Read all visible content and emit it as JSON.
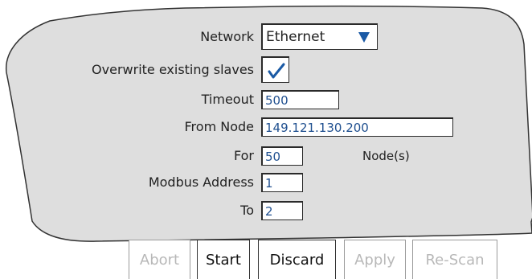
{
  "form": {
    "network_label": "Network",
    "network_value": "Ethernet",
    "overwrite_label": "Overwrite existing slaves",
    "overwrite_checked": true,
    "timeout_label": "Timeout",
    "timeout_value": "500",
    "from_node_label": "From Node",
    "from_node_value": "149.121.130.200",
    "for_label": "For",
    "for_value": "50",
    "for_unit": "Node(s)",
    "modbus_address_label": "Modbus Address",
    "modbus_address_value": "1",
    "to_label": "To",
    "to_value": "2"
  },
  "buttons": {
    "abort": "Abort",
    "start": "Start",
    "discard": "Discard",
    "apply": "Apply",
    "rescan": "Re-Scan"
  },
  "colors": {
    "panel": "#dedede",
    "value_text": "#1f4f8f",
    "accent": "#1a5aa5",
    "disabled_text": "#b8b8b8"
  },
  "icons": {
    "dropdown": "triangle-down-icon",
    "checkbox": "checkmark-icon"
  }
}
